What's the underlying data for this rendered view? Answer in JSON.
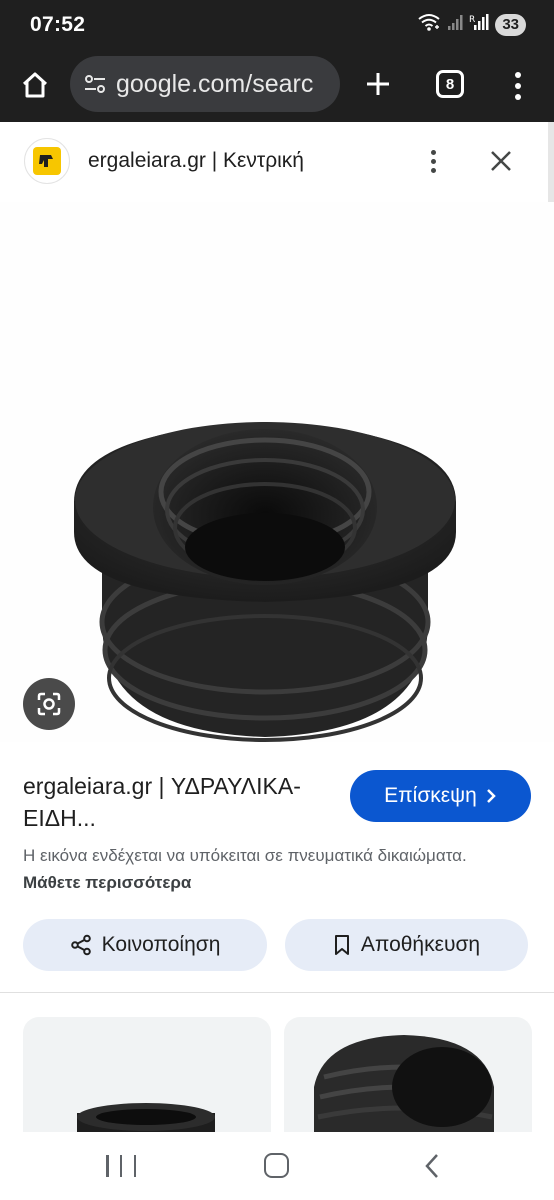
{
  "status_bar": {
    "time": "07:52",
    "battery": "33",
    "icons": [
      "wifi-icon",
      "signal-icon",
      "signal-r-icon",
      "battery-icon"
    ]
  },
  "browser": {
    "url": "google.com/searc",
    "tab_count": "8",
    "icons": [
      "home-icon",
      "site-settings-icon",
      "plus-icon",
      "menu-icon"
    ]
  },
  "panel": {
    "site_name": "ergaleiara.gr | Κεντρική",
    "result_title": "ergaleiara.gr | ΥΔΡΑΥΛΙΚΑ-ΕΙΔΗ...",
    "visit_label": "Επίσκεψη",
    "copyright_text": "Η εικόνα ενδέχεται να υπόκειται σε πνευματικά δικαιώματα.",
    "learn_more": "Μάθετε περισσότερα",
    "share_label": "Κοινοποίηση",
    "save_label": "Αποθήκευση",
    "accent_color": "#0b57d0",
    "icons": [
      "favicon",
      "more-vert-icon",
      "close-icon",
      "lens-icon",
      "chevron-right-icon",
      "share-icon",
      "bookmark-icon"
    ]
  },
  "nav_bar": {
    "icons": [
      "recents-icon",
      "home-circle-icon",
      "back-icon"
    ]
  }
}
